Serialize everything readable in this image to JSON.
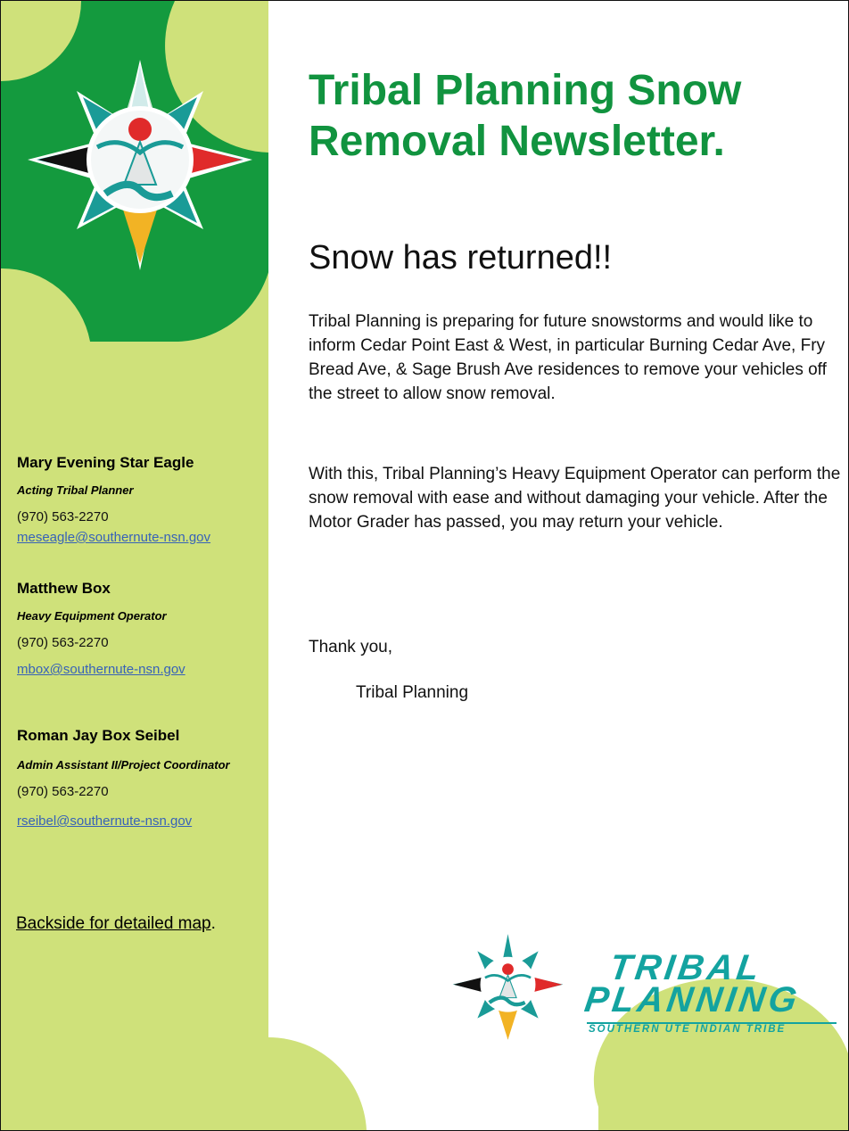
{
  "header": {
    "title": "Tribal Planning Snow Removal Newsletter.",
    "subtitle": "Snow has returned!!"
  },
  "body": {
    "paragraph1": "Tribal Planning is preparing for future snowstorms and would like to inform Cedar Point East & West, in particular Burning Cedar Ave, Fry Bread Ave, & Sage Brush Ave residences to remove your vehicles off the street to allow snow removal.",
    "paragraph2": "With this, Tribal Planning’s Heavy Equipment Operator can perform the snow removal with ease and without damaging your vehicle. After the Motor Grader has passed, you may return your vehicle.",
    "closing": "Thank you,",
    "signature": "Tribal Planning"
  },
  "contacts": [
    {
      "name": "Mary Evening Star Eagle",
      "role": "Acting Tribal Planner",
      "phone": "(970) 563-2270",
      "email": "meseagle@southernute-nsn.gov"
    },
    {
      "name": "Matthew Box",
      "role": "Heavy Equipment Operator",
      "phone": "(970) 563-2270",
      "email": "mbox@southernute-nsn.gov"
    },
    {
      "name": "Roman Jay Box Seibel",
      "role": "Admin Assistant II/Project Coordinator",
      "phone": "(970) 563-2270",
      "email": "rseibel@southernute-nsn.gov"
    }
  ],
  "footer": {
    "backside_link": "Backside for detailed map",
    "backside_period": "."
  },
  "branding": {
    "line1": "TRIBAL",
    "line2": "PLANNING",
    "tagline": "SOUTHERN UTE INDIAN TRIBE"
  },
  "colors": {
    "title_green": "#11933f",
    "dark_green": "#149a3e",
    "lime": "#cfe17a",
    "teal": "#13a3a0",
    "link_blue": "#3762b8"
  }
}
